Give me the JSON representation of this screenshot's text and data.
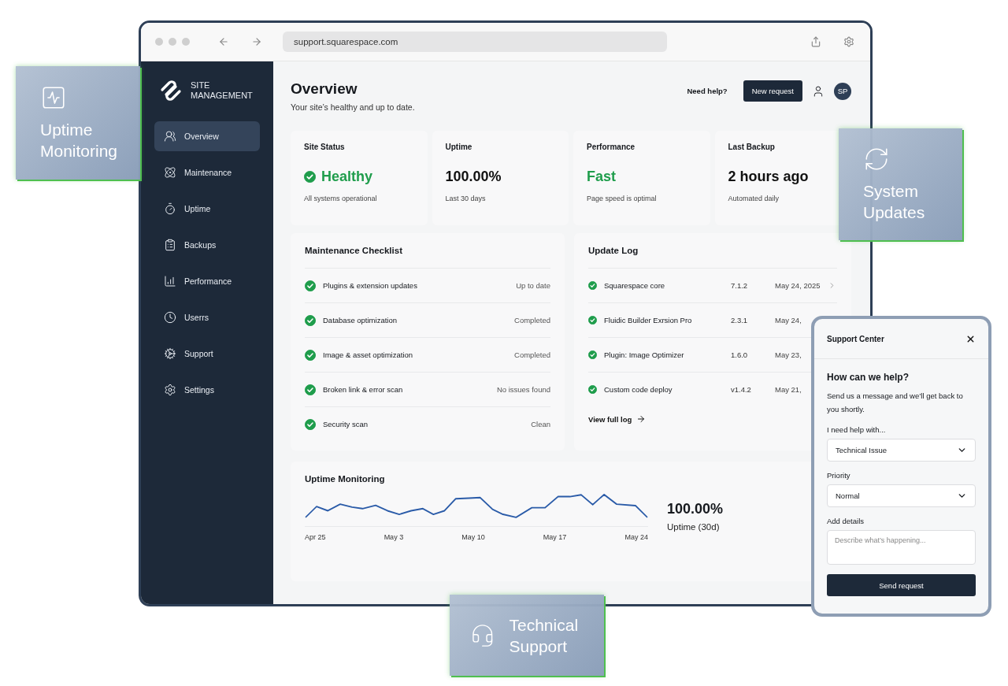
{
  "floating_cards": [
    {
      "label": "Uptime Monitoring"
    },
    {
      "label": "System Updates"
    },
    {
      "label": "Technical Support"
    }
  ],
  "browser": {
    "url": "support.squarespace.com"
  },
  "sidebar": {
    "brand": "SITE MANAGEMENT",
    "items": [
      {
        "label": "Overview",
        "selected": true
      },
      {
        "label": "Maintenance",
        "selected": false
      },
      {
        "label": "Uptime",
        "selected": false
      },
      {
        "label": "Backups",
        "selected": false
      },
      {
        "label": "Performance",
        "selected": false
      },
      {
        "label": "Userrs",
        "selected": false
      },
      {
        "label": "Support",
        "selected": false
      },
      {
        "label": "Settings",
        "selected": false
      }
    ]
  },
  "header": {
    "title": "Overview",
    "subtitle": "Your site’s healthy and up to date.",
    "help": "Need help?",
    "button": "New request",
    "avatar": "SP"
  },
  "stats": [
    {
      "kind": "status",
      "label": "Site Status",
      "value": "Healthy",
      "note": "All systems operational"
    },
    {
      "kind": "plain",
      "label": "Uptime",
      "value": "100.00%",
      "note": "Last 30 days"
    },
    {
      "kind": "good",
      "label": "Performance",
      "value": "Fast",
      "note": "Page speed is optimal"
    },
    {
      "kind": "plain",
      "label": "Last Backup",
      "value": "2 hours ago",
      "note": "Automated daily"
    }
  ],
  "checklist": {
    "title": "Maintenance Checklist",
    "items": [
      {
        "label": "Plugins & extension updates",
        "status": "Up to date",
        "checked": true
      },
      {
        "label": "Database optimization",
        "status": "Completed",
        "checked": true
      },
      {
        "label": "Image & asset optimization",
        "status": "Completed",
        "checked": true
      },
      {
        "label": "Broken link & error scan",
        "status": "No issues found",
        "checked": true
      },
      {
        "label": "Security scan",
        "status": "Clean",
        "checked": true
      }
    ]
  },
  "update_log": {
    "title": "Update Log",
    "rows": [
      {
        "name": "Squarespace core",
        "version": "7.1.2",
        "date": "May 24, 2025",
        "checked": true,
        "arrow": true
      },
      {
        "name": "Fluidic Builder Exrsion Pro",
        "version": "2.3.1",
        "date": "May 24,",
        "checked": true,
        "arrow": false
      },
      {
        "name": "Plugin: Image Optimizer",
        "version": "1.6.0",
        "date": "May 23,",
        "checked": true,
        "arrow": false
      },
      {
        "name": "Custom code deploy",
        "version": "v1.4.2",
        "date": "May 21,",
        "checked": true,
        "arrow": false
      }
    ],
    "link": "View full log"
  },
  "uptime": {
    "title": "Uptime Monitoring",
    "axis_labels": [
      "Apr 25",
      "May 3",
      "May 10",
      "May 17",
      "May 24"
    ],
    "value": "100.00%",
    "caption": "Uptime (30d)"
  },
  "support_panel": {
    "title": "Support Center",
    "heading": "How can we help?",
    "text": "Send us a message and we’ll get back to you shortly.",
    "fields": [
      {
        "kind": "select",
        "label": "I need help with...",
        "value": "Technical Issue"
      },
      {
        "kind": "select",
        "label": "Priority",
        "value": "Normal"
      },
      {
        "kind": "textarea",
        "label": "Add details",
        "placeholder": "Describe what’s happening..."
      }
    ],
    "button": "Send request"
  }
}
